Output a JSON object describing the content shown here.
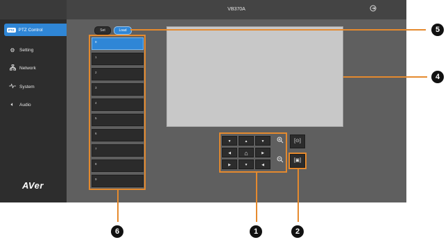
{
  "app": {
    "title": "VB370A"
  },
  "sidebar": {
    "items": [
      {
        "badge": "PTZ",
        "label": "PTZ Control",
        "icon": "ptz-icon",
        "active": true
      },
      {
        "label": "Setting",
        "icon": "gear-icon",
        "active": false
      },
      {
        "label": "Network",
        "icon": "network-icon",
        "active": false
      },
      {
        "label": "System",
        "icon": "system-icon",
        "active": false
      },
      {
        "label": "Audio",
        "icon": "speaker-icon",
        "active": false
      }
    ],
    "logo": "AVer"
  },
  "preset_controls": {
    "set_label": "Set",
    "load_label": "Load"
  },
  "presets": [
    "0",
    "1",
    "2",
    "3",
    "4",
    "5",
    "6",
    "7",
    "8",
    "9"
  ],
  "callouts": [
    "1",
    "2",
    "4",
    "5",
    "6"
  ],
  "colors": {
    "accent": "#2f86d6",
    "callout": "#e58a2e",
    "sidebar": "#2d2d2d",
    "main": "#5f5f5f"
  }
}
